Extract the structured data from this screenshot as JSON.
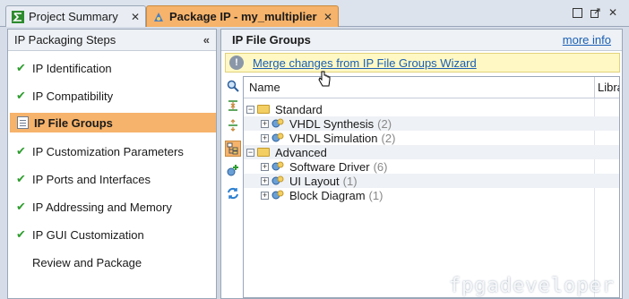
{
  "tabs": [
    {
      "label": "Project Summary",
      "icon": "sigma-icon"
    },
    {
      "label": "Package IP - my_multiplier",
      "icon": "ip-package-icon"
    }
  ],
  "window_controls": [
    "restore-icon",
    "maximize-icon",
    "close-icon"
  ],
  "left_panel": {
    "title": "IP Packaging Steps",
    "steps": [
      {
        "label": "IP Identification",
        "done": true
      },
      {
        "label": "IP Compatibility",
        "done": true
      },
      {
        "label": "IP File Groups",
        "selected": true
      },
      {
        "label": "IP Customization Parameters",
        "done": true
      },
      {
        "label": "IP Ports and Interfaces",
        "done": true
      },
      {
        "label": "IP Addressing and Memory",
        "done": true
      },
      {
        "label": "IP GUI Customization",
        "done": true
      },
      {
        "label": "Review and Package",
        "done": false
      }
    ]
  },
  "right_panel": {
    "title": "IP File Groups",
    "more_info": "more info",
    "banner_link": "Merge changes from IP File Groups Wizard",
    "columns": [
      "Name",
      "Libra"
    ],
    "tree": [
      {
        "label": "Standard",
        "level": 0
      },
      {
        "label": "VHDL Synthesis",
        "count": "(2)",
        "level": 1
      },
      {
        "label": "VHDL Simulation",
        "count": "(2)",
        "level": 1
      },
      {
        "label": "Advanced",
        "level": 0
      },
      {
        "label": "Software Driver",
        "count": "(6)",
        "level": 1
      },
      {
        "label": "UI Layout",
        "count": "(1)",
        "level": 1
      },
      {
        "label": "Block Diagram",
        "count": "(1)",
        "level": 1
      }
    ]
  },
  "watermark": "fpgadeveloper"
}
